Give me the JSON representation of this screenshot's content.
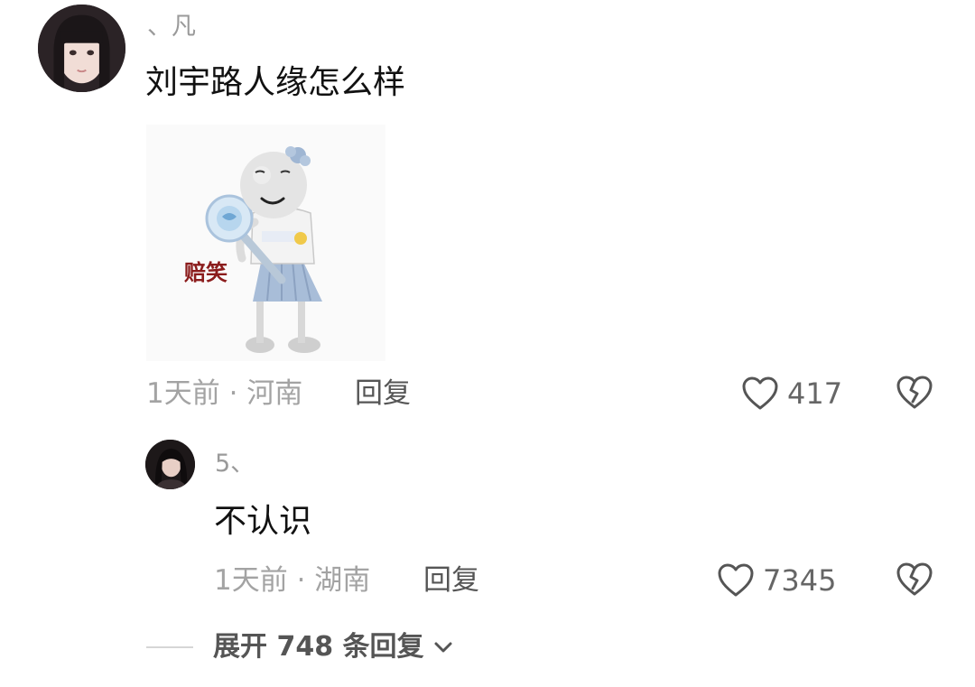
{
  "comments": [
    {
      "username": "、凡",
      "text": "刘宇路人缘怎么样",
      "sticker_caption": "赔笑",
      "meta": "1天前 · 河南",
      "reply_label": "回复",
      "likes": "417",
      "icons": {
        "like": "heart-outline-icon",
        "dislike": "broken-heart-icon"
      }
    },
    {
      "username": "5、",
      "text": "不认识",
      "meta": "1天前 · 湖南",
      "reply_label": "回复",
      "likes": "7345",
      "icons": {
        "like": "heart-outline-icon",
        "dislike": "broken-heart-icon"
      }
    }
  ],
  "expand_replies": {
    "label": "展开 748 条回复",
    "icon": "chevron-down-icon"
  },
  "colors": {
    "meta_text": "#a3a3a3",
    "username": "#9a9a9a",
    "sticker_caption": "#8b1c1c"
  }
}
